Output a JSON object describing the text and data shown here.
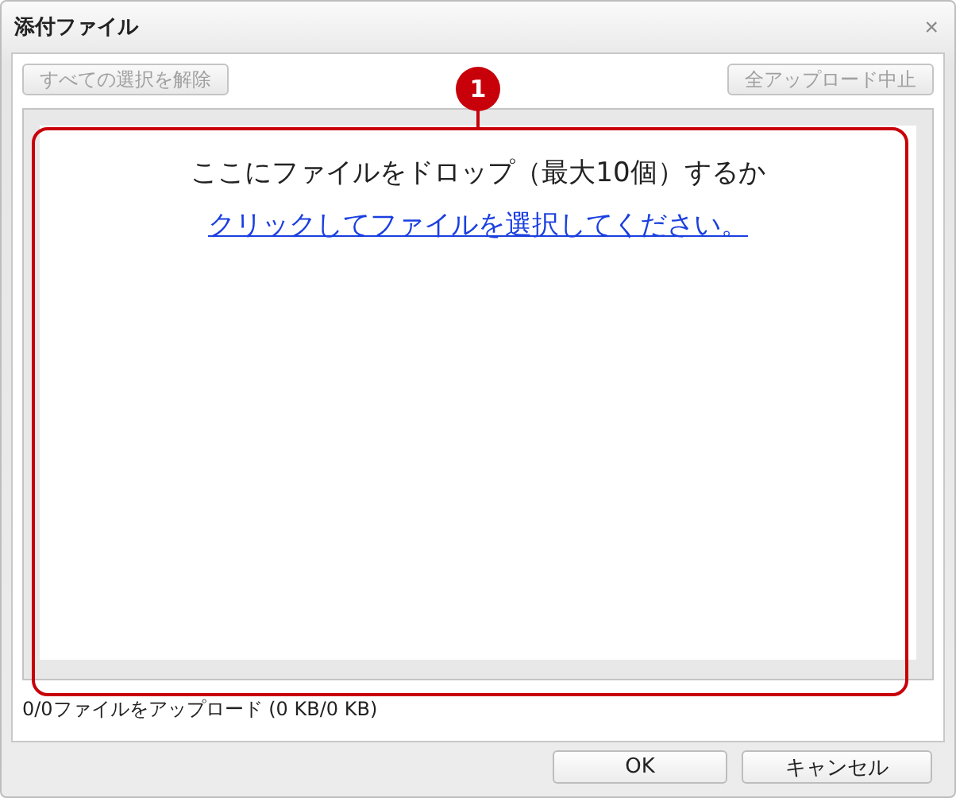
{
  "window": {
    "title": "添付ファイル",
    "close": "×"
  },
  "toolbar": {
    "buttons": [
      {
        "label": "すべての選択を解除",
        "disabled": true
      },
      {
        "label": "全アップロード中止",
        "disabled": true
      }
    ]
  },
  "drop_zone": {
    "message": "ここにファイルをドロップ（最大10個）するか",
    "link": "クリックしてファイルを選択してください。"
  },
  "callout": {
    "number": "1"
  },
  "status": "0/0ファイルをアップロード (0 KB/0 KB)",
  "footer": {
    "buttons": [
      {
        "label": "OK"
      },
      {
        "label": "キャンセル"
      }
    ]
  }
}
